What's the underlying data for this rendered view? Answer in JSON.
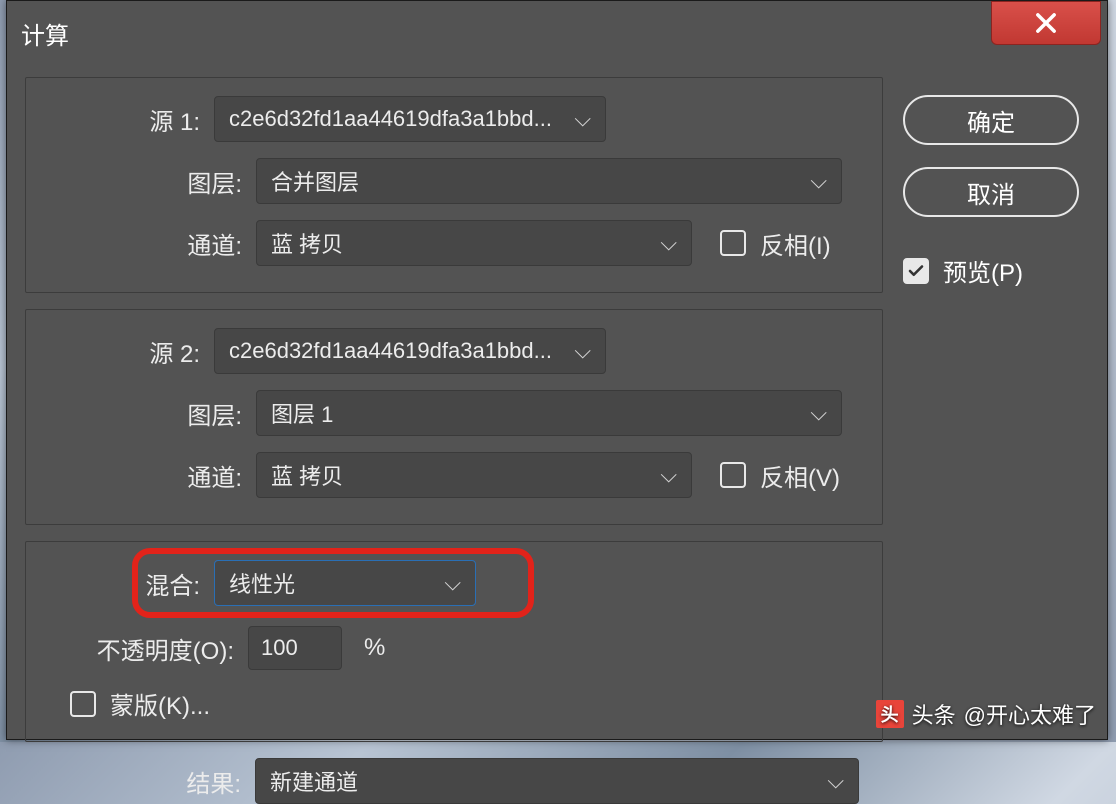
{
  "title": "计算",
  "buttons": {
    "ok": "确定",
    "cancel": "取消"
  },
  "preview": {
    "label": "预览(P)",
    "checked": true
  },
  "source1": {
    "label": "源 1:",
    "file": "c2e6d32fd1aa44619dfa3a1bbd...",
    "layer_label": "图层:",
    "layer": "合并图层",
    "channel_label": "通道:",
    "channel": "蓝 拷贝",
    "invert": "反相(I)",
    "invert_checked": false
  },
  "source2": {
    "label": "源 2:",
    "file": "c2e6d32fd1aa44619dfa3a1bbd...",
    "layer_label": "图层:",
    "layer": "图层 1",
    "channel_label": "通道:",
    "channel": "蓝 拷贝",
    "invert": "反相(V)",
    "invert_checked": false
  },
  "blend": {
    "label": "混合:",
    "mode": "线性光"
  },
  "opacity": {
    "label": "不透明度(O):",
    "value": "100",
    "unit": "%"
  },
  "mask": {
    "label": "蒙版(K)...",
    "checked": false
  },
  "result": {
    "label": "结果:",
    "value": "新建通道"
  },
  "watermark": {
    "brand": "头条",
    "handle": "@开心太难了"
  }
}
